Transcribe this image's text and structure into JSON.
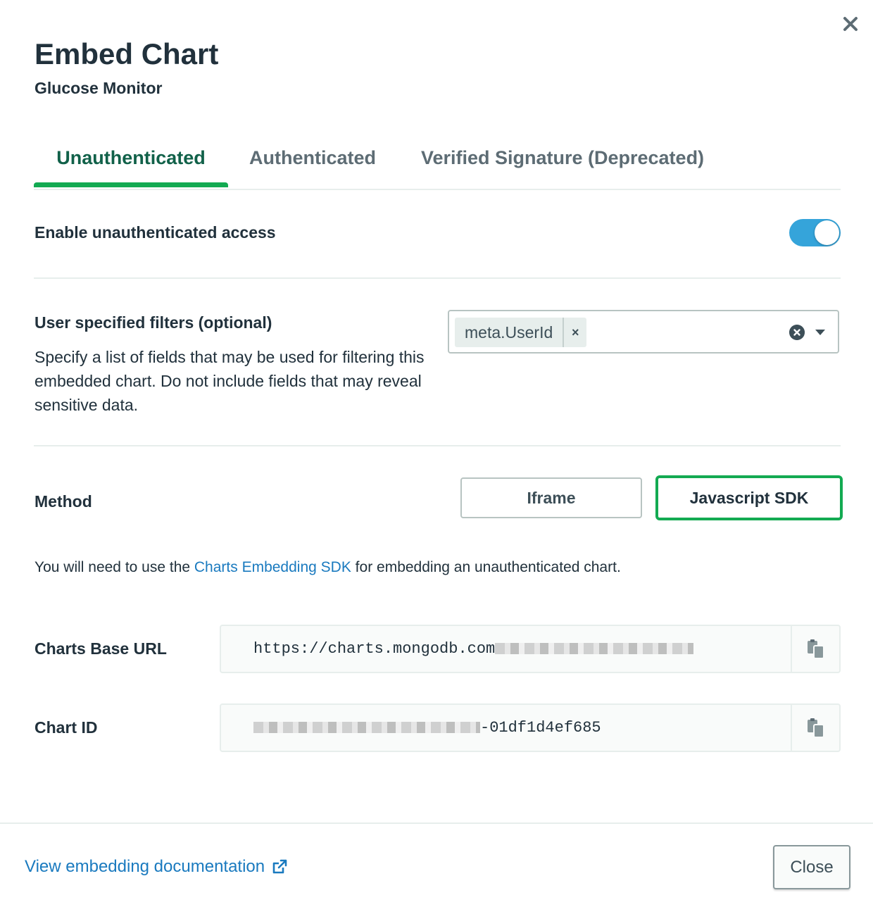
{
  "dialog": {
    "title": "Embed Chart",
    "subtitle": "Glucose Monitor"
  },
  "tabs": [
    {
      "label": "Unauthenticated",
      "active": true
    },
    {
      "label": "Authenticated",
      "active": false
    },
    {
      "label": "Verified Signature (Deprecated)",
      "active": false
    }
  ],
  "access": {
    "label": "Enable unauthenticated access",
    "enabled": true
  },
  "filters": {
    "label": "User specified filters (optional)",
    "description": "Specify a list of fields that may be used for filtering this embedded chart. Do not include fields that may reveal sensitive data.",
    "selected": [
      "meta.UserId"
    ],
    "remove_glyph": "×"
  },
  "method": {
    "label": "Method",
    "options": [
      "Iframe",
      "Javascript SDK"
    ],
    "selected": "Javascript SDK"
  },
  "info": {
    "prefix": "You will need to use the ",
    "link": "Charts Embedding SDK",
    "suffix": " for embedding an unauthenticated chart."
  },
  "base_url": {
    "label": "Charts Base URL",
    "value": "https://charts.mongodb.com"
  },
  "chart_id": {
    "label": "Chart ID",
    "value_suffix": "-01df1d4ef685"
  },
  "footer": {
    "doc_link": "View embedding documentation",
    "close_label": "Close"
  },
  "colors": {
    "accent_green": "#13aa52",
    "active_tab_text": "#116149",
    "toggle_blue": "#35a4da",
    "link_blue": "#1a7abf"
  },
  "icons": [
    "close-icon",
    "chip-remove-icon",
    "clear-icon",
    "dropdown-caret-icon",
    "copy-icon",
    "external-link-icon"
  ]
}
